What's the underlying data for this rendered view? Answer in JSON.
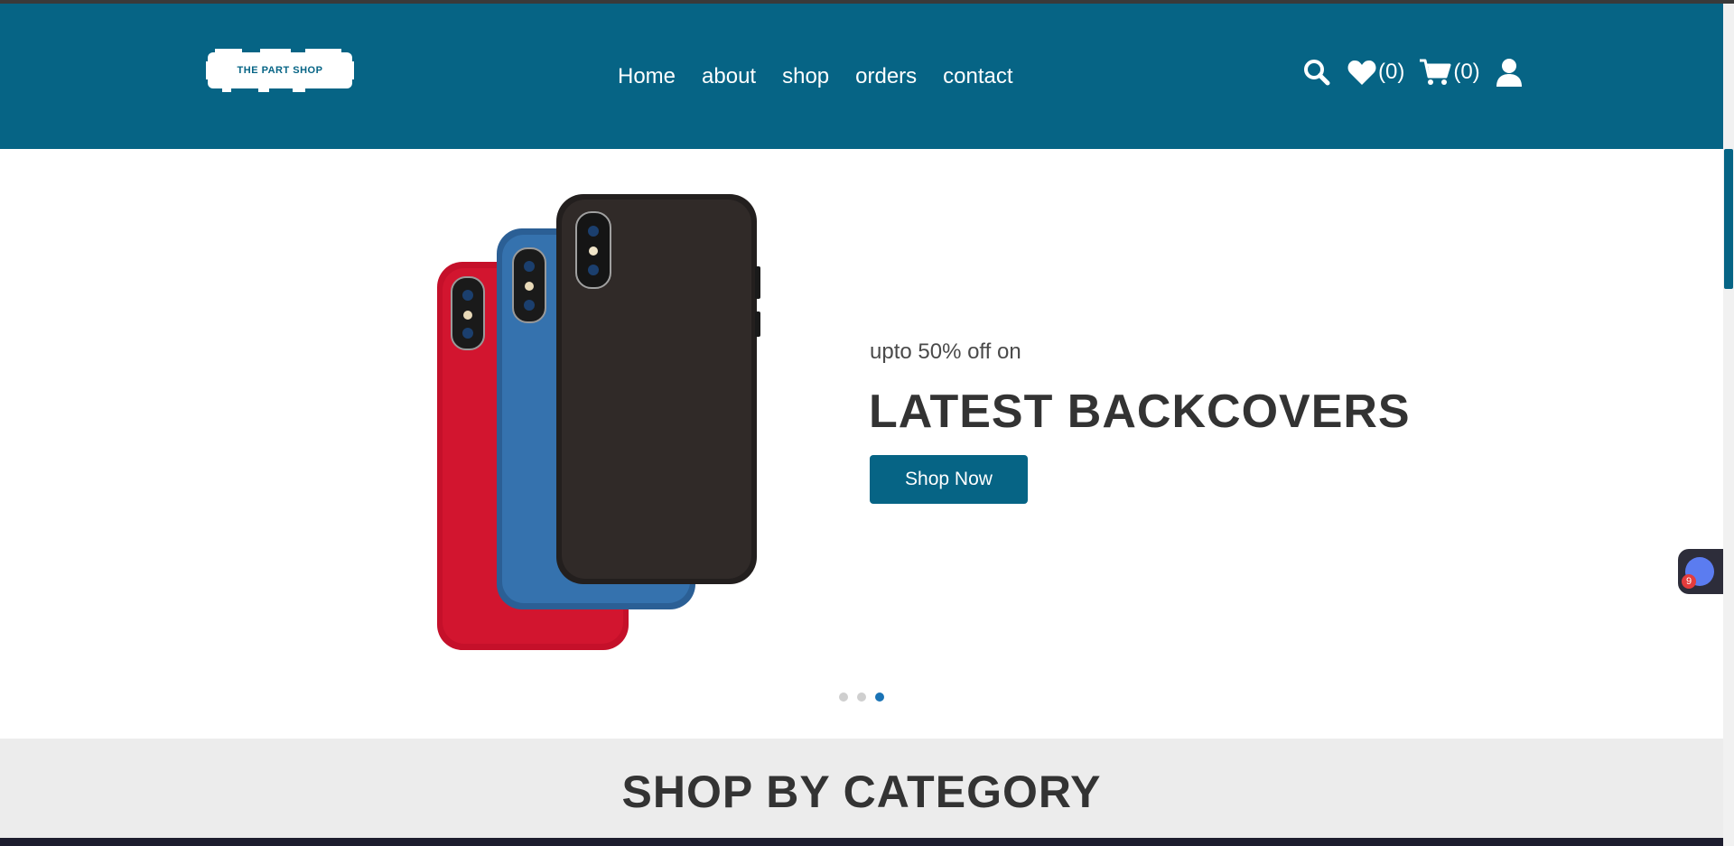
{
  "brand": {
    "logo_text": "THE PART SHOP",
    "primary_color": "#066485",
    "accent_color": "#1a73b5"
  },
  "nav": {
    "items": [
      {
        "label": "Home"
      },
      {
        "label": "about"
      },
      {
        "label": "shop"
      },
      {
        "label": "orders"
      },
      {
        "label": "contact"
      }
    ]
  },
  "header_icons": {
    "search": "search-icon",
    "wishlist": "heart-icon",
    "wishlist_count": "(0)",
    "cart": "cart-icon",
    "cart_count": "(0)",
    "account": "user-icon"
  },
  "hero": {
    "subtext": "upto 50% off on",
    "headline": "LATEST BACKCOVERS",
    "cta_label": "Shop Now",
    "image": "phone-backcovers-image",
    "slides_total": 3,
    "active_slide": 3
  },
  "category_section": {
    "title": "SHOP BY CATEGORY"
  },
  "chat_widget": {
    "icon": "chat-bot-icon",
    "badge_count": "9"
  }
}
